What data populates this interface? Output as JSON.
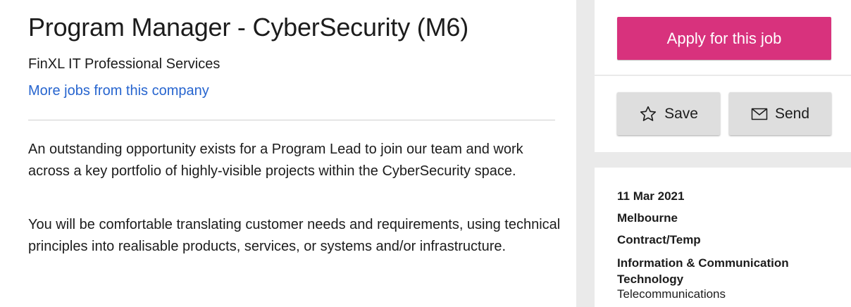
{
  "job": {
    "title": "Program Manager - CyberSecurity (M6)",
    "company": "FinXL IT Professional Services",
    "more_jobs_link": "More jobs from this company",
    "description": [
      "An outstanding opportunity exists for a Program Lead to join our team and work across a key portfolio of highly-visible projects within the CyberSecurity space.",
      "You will be comfortable translating customer needs and requirements, using technical principles into realisable products, services, or systems and/or infrastructure."
    ]
  },
  "actions": {
    "apply_label": "Apply for this job",
    "save_label": "Save",
    "send_label": "Send",
    "save_icon": "star-icon",
    "send_icon": "envelope-icon"
  },
  "details": {
    "date": "11 Mar 2021",
    "location": "Melbourne",
    "work_type": "Contract/Temp",
    "classification": "Information & Communication Technology",
    "sub_classification": "Telecommunications"
  },
  "colors": {
    "apply_button": "#d8327d",
    "link": "#2765cf",
    "action_button": "#dedede",
    "page_background": "#eaeaea"
  }
}
